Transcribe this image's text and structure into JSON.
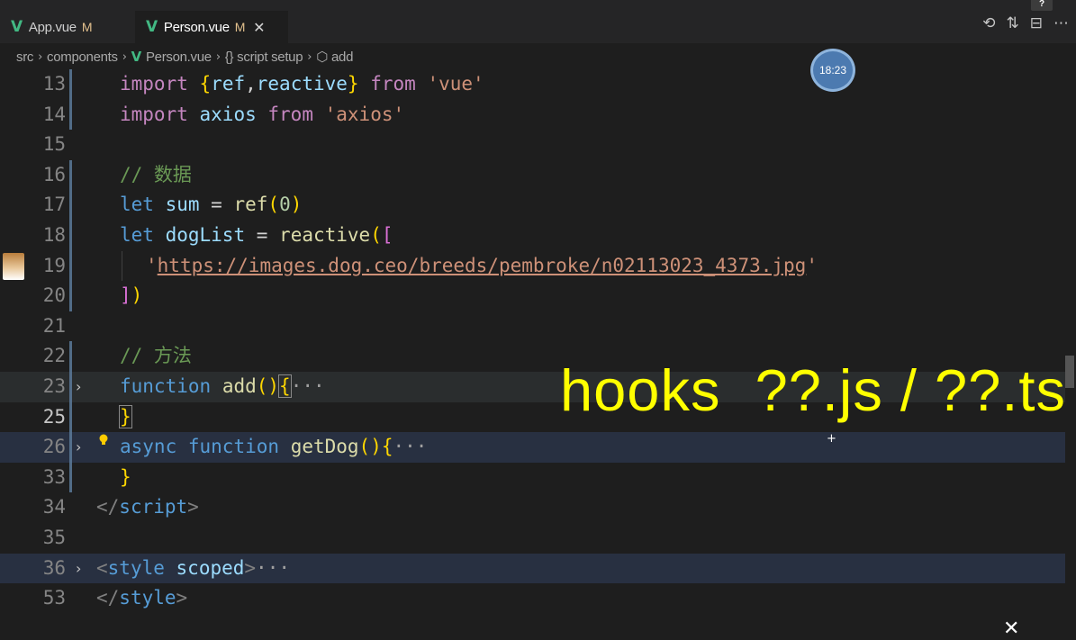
{
  "tabs": [
    {
      "label": "App.vue",
      "status": "M"
    },
    {
      "label": "Person.vue",
      "status": "M"
    }
  ],
  "header_actions": {
    "badge": "?"
  },
  "breadcrumb": {
    "root": "src",
    "folder": "components",
    "file": "Person.vue",
    "section": "script setup",
    "symbol": "add"
  },
  "clock_badge": "18:23",
  "overlay_text": "hooks  ??.js / ??.ts",
  "code_tokens": {
    "import": "import",
    "from": "from",
    "let": "let",
    "function": "function",
    "async": "async",
    "ref": "ref",
    "reactive": "reactive",
    "vue_str": "'vue'",
    "axios": "axios",
    "axios_str": "'axios'",
    "comment_data": "// 数据",
    "sum": "sum",
    "zero": "0",
    "dogList": "dogList",
    "url": "https://images.dog.ceo/breeds/pembroke/n02113023_4373.jpg",
    "comment_methods": "// 方法",
    "add": "add",
    "getDog": "getDog",
    "script_tag": "script",
    "style_tag": "style",
    "scoped": "scoped",
    "ellipsis": "···"
  },
  "line_numbers": [
    "13",
    "14",
    "15",
    "16",
    "17",
    "18",
    "19",
    "20",
    "21",
    "22",
    "23",
    "25",
    "26",
    "33",
    "34",
    "35",
    "36",
    "53"
  ],
  "colors": {
    "editor_bg": "#1e1e1e",
    "keyword": "#569cd6",
    "control": "#c586c0",
    "string": "#ce9178",
    "comment": "#6a9955",
    "variable": "#9cdcfe",
    "function": "#dcdcaa",
    "overlay": "#ffff00",
    "vue_green": "#42b883"
  }
}
